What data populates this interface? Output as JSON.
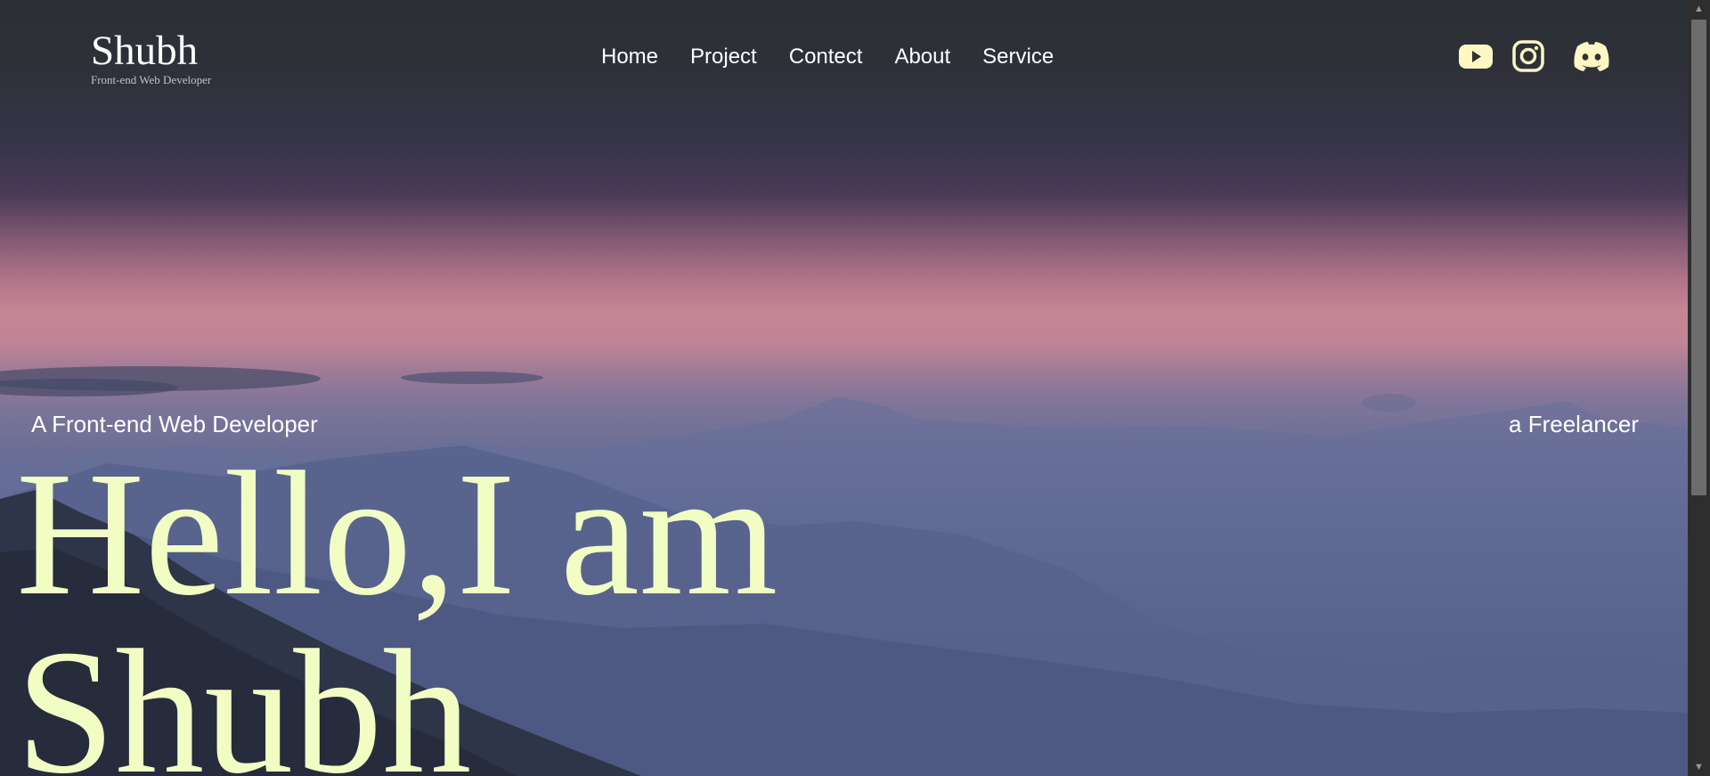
{
  "brand": {
    "name": "Shubh",
    "subtitle": "Front-end Web Developer"
  },
  "nav": {
    "items": [
      {
        "label": "Home"
      },
      {
        "label": "Project"
      },
      {
        "label": "Contect"
      },
      {
        "label": "About"
      },
      {
        "label": "Service"
      }
    ]
  },
  "socials": {
    "icons": [
      "youtube-icon",
      "instagram-icon",
      "discord-icon"
    ],
    "icon_color": "#fdf7c3"
  },
  "hero": {
    "tag_left": "A Front-end Web Developer",
    "tag_right": "a Freelancer",
    "headline_line1": "Hello,I am",
    "headline_line2": "Shubh",
    "headline_color": "#f2fdc4"
  },
  "scrollbar": {
    "up_glyph": "▲",
    "down_glyph": "▼"
  }
}
